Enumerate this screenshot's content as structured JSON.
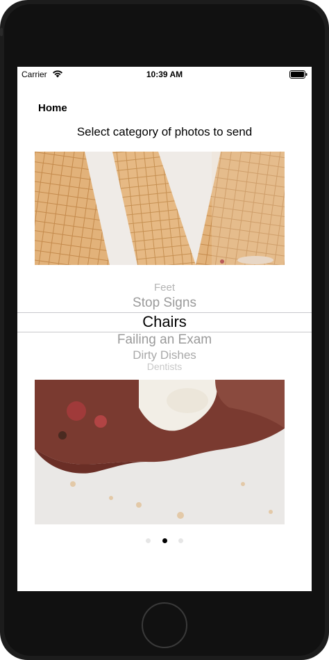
{
  "status_bar": {
    "carrier": "Carrier",
    "time": "10:39 AM",
    "wifi_icon": "wifi-icon",
    "battery_icon": "battery-icon"
  },
  "nav": {
    "title": "Home"
  },
  "prompt": "Select category of photos to send",
  "photos": {
    "top_icon": "ice-cream-cones-photo",
    "bottom_icon": "melted-ice-cream-photo"
  },
  "picker": {
    "items": [
      "Feet",
      "Stop Signs",
      "Chairs",
      "Failing an Exam",
      "Dirty Dishes",
      "Dentists"
    ],
    "selected": "Chairs"
  },
  "page_control": {
    "total": 3,
    "current": 2
  },
  "colors": {
    "frame": "#1c1c1c",
    "screen_bg": "#ffffff",
    "picker_inactive": "#9a9a9a",
    "picker_active": "#000000"
  }
}
